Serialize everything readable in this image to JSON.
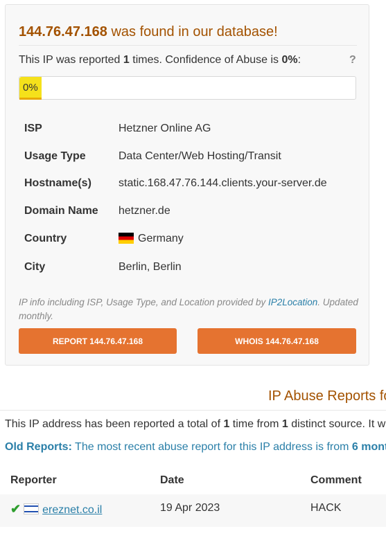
{
  "summary": {
    "ip": "144.76.47.168",
    "found_suffix": " was found in our database!",
    "reported_prefix": "This IP was reported ",
    "report_count": "1",
    "reported_mid": " times. Confidence of Abuse is ",
    "confidence": "0%",
    "confidence_suffix": ":",
    "help": "?",
    "confidence_fraction": 0.0,
    "bar_label": "0%"
  },
  "details": [
    {
      "label": "ISP",
      "value": "Hetzner Online AG"
    },
    {
      "label": "Usage Type",
      "value": "Data Center/Web Hosting/Transit"
    },
    {
      "label": "Hostname(s)",
      "value": "static.168.47.76.144.clients.your-server.de"
    },
    {
      "label": "Domain Name",
      "value": "hetzner.de"
    },
    {
      "label": "Country",
      "value": "Germany",
      "flag": "germany-flag-icon"
    },
    {
      "label": "City",
      "value": "Berlin, Berlin"
    }
  ],
  "note": {
    "text": "IP info including ISP, Usage Type, and Location provided by ",
    "link": "IP2Location",
    "text2": ". Updated monthly."
  },
  "buttons": {
    "report": "REPORT 144.76.47.168",
    "whois": "WHOIS 144.76.47.168"
  },
  "reports": {
    "heading": "IP Abuse Reports fo",
    "para_a": "This IP address has been reported a total of ",
    "para_b": "1",
    "para_c": " time from ",
    "para_d": "1",
    "para_e": " distinct source. It wa",
    "old_label": "Old Reports:",
    "old_text": " The most recent abuse report for this IP address is from ",
    "old_tail": "6 mont",
    "columns": [
      "Reporter",
      "Date",
      "Comment"
    ],
    "rows": [
      {
        "reporter": "ereznet.co.il",
        "date": "19 Apr 2023",
        "comment": "HACK",
        "flag": "israel-flag-icon",
        "status": "check-icon"
      }
    ]
  }
}
